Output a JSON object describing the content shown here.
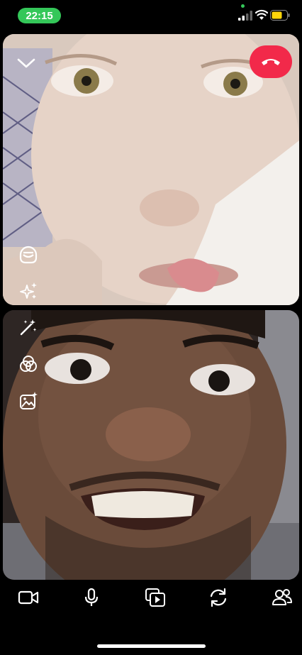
{
  "status": {
    "time": "22:15",
    "icons": [
      "cellular-signal-icon",
      "wifi-icon",
      "battery-icon"
    ],
    "time_pill_color": "#34c759",
    "battery_color": "#ffd60a"
  },
  "call": {
    "end_call_color": "#f2294a",
    "left_tools": [
      "lens-icon",
      "sparkles-icon",
      "magic-wand-icon",
      "color-filter-icon",
      "image-effect-icon"
    ]
  },
  "bottom_bar": {
    "buttons": [
      "video-camera-icon",
      "microphone-icon",
      "share-screen-icon",
      "switch-camera-icon",
      "participants-icon"
    ]
  }
}
